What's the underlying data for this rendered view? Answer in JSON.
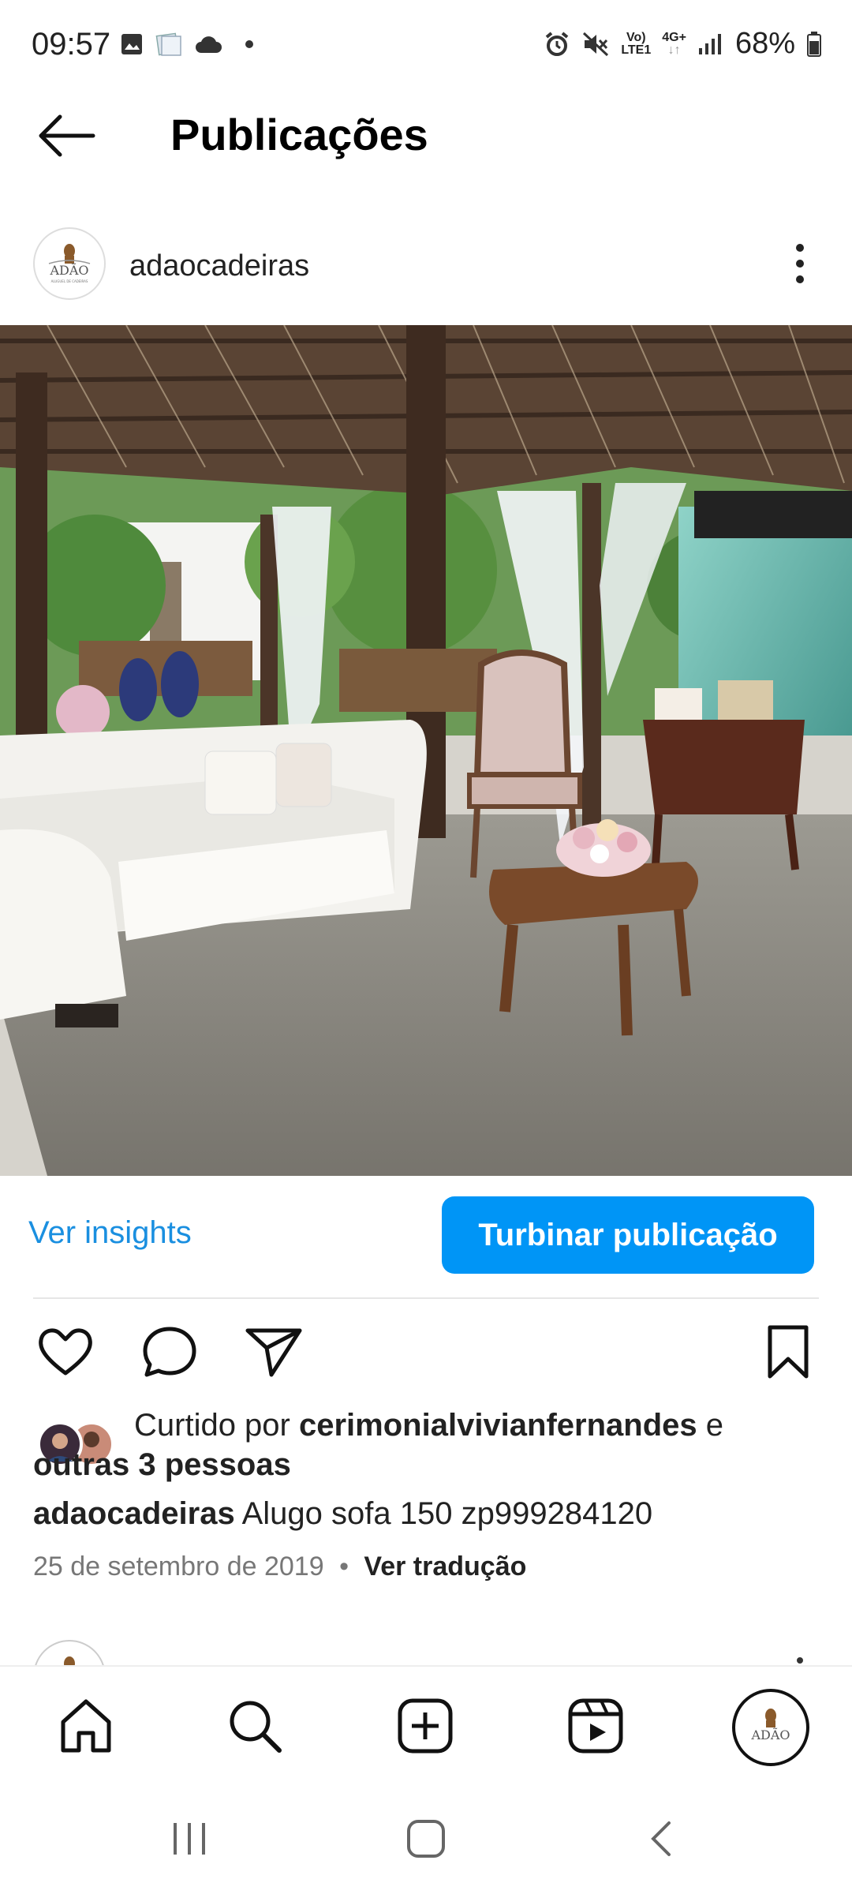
{
  "status_bar": {
    "time": "09:57",
    "left_icons": [
      "image-icon",
      "notes-icon",
      "cloud-icon",
      "dot-icon"
    ],
    "network_top": "Vo)",
    "network_bottom": "LTE1",
    "network_type": "4G+",
    "battery": "68%"
  },
  "header": {
    "title": "Publicações",
    "back_icon": "arrow-left-icon"
  },
  "post": {
    "username": "adaocadeiras",
    "avatar_brand": "ADÃO",
    "avatar_sub": "ALUGUEL DE CADEIRAS",
    "insights_label": "Ver insights",
    "boost_label": "Turbinar publicação",
    "liked_prefix": "Curtido por",
    "liked_user": "cerimonialvivianfernandes",
    "liked_conj": "e",
    "liked_others": "outras 3 pessoas",
    "caption_user": "adaocadeiras",
    "caption_text": "Alugo sofa 150 zp999284120",
    "date": "25 de setembro de 2019",
    "separator": "•",
    "translate_label": "Ver tradução"
  },
  "colors": {
    "accent": "#0095f6",
    "link": "#1a8fe0"
  }
}
